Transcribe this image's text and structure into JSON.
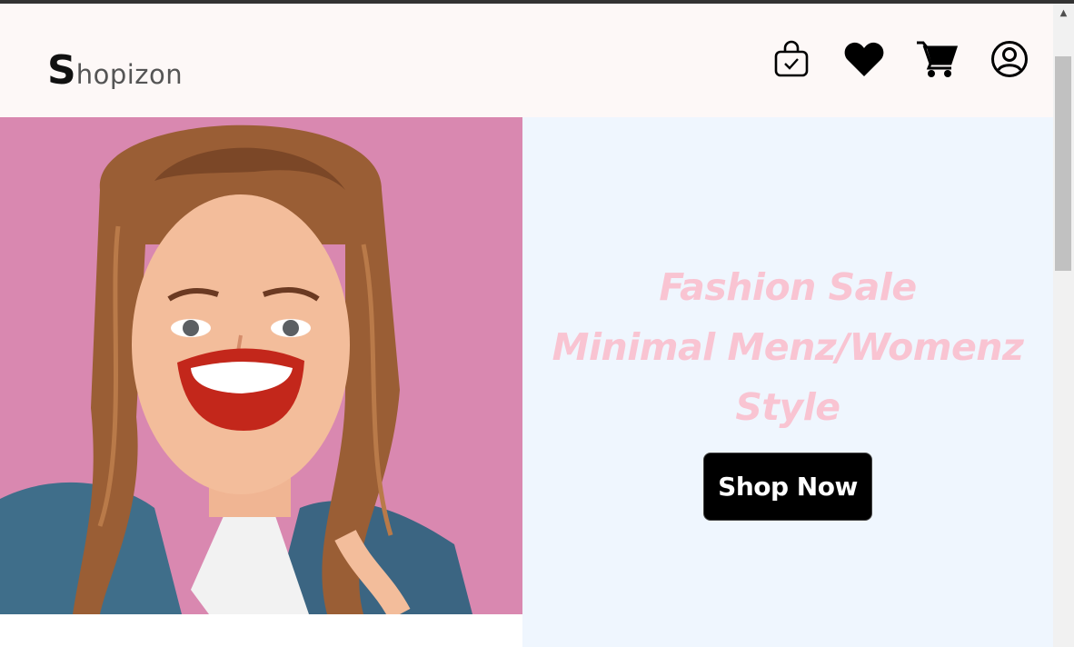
{
  "brand": {
    "initial": "S",
    "rest": "hopizon"
  },
  "nav": {
    "icons": [
      {
        "name": "shopping-bag-check-icon",
        "label": "Orders"
      },
      {
        "name": "heart-icon",
        "label": "Wishlist"
      },
      {
        "name": "cart-icon",
        "label": "Cart"
      },
      {
        "name": "user-icon",
        "label": "Account"
      }
    ]
  },
  "hero": {
    "line1": "Fashion Sale",
    "line2": "Minimal Menz/Womenz",
    "line3": "Style",
    "button_label": "Shop Now",
    "image_alt": "Smiling woman in denim jacket against pink background"
  },
  "colors": {
    "navbar_bg": "#fdf8f7",
    "hero_bg": "#eff6fe",
    "hero_text": "#f9c4d2",
    "button_bg": "#000000",
    "image_bg": "#d37da6"
  },
  "scrollbar": {
    "up_arrow": "▲"
  }
}
